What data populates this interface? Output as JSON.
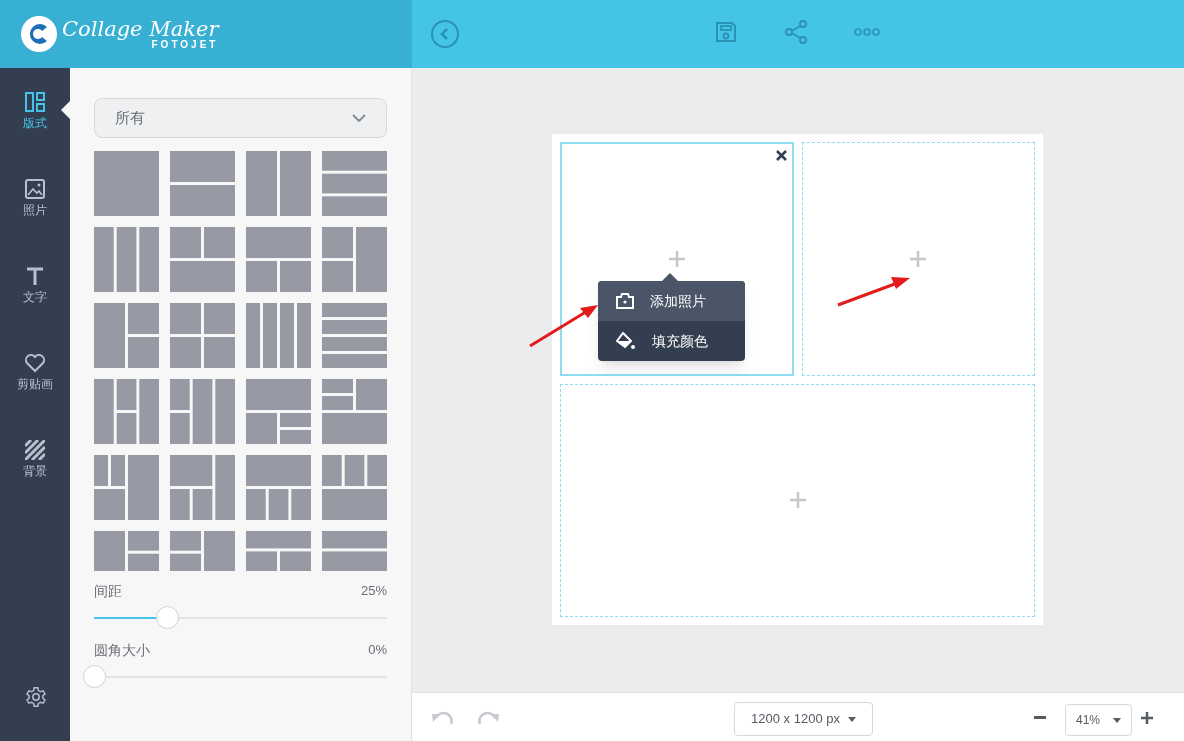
{
  "logo": {
    "title": "Collage Maker",
    "subtitle": "FOTOJET"
  },
  "nav": [
    {
      "kind": "layout",
      "label": "版式",
      "selected": true
    },
    {
      "kind": "photo",
      "label": "照片",
      "selected": false
    },
    {
      "kind": "text",
      "label": "文字",
      "selected": false
    },
    {
      "kind": "clipart",
      "label": "剪贴画",
      "selected": false
    },
    {
      "kind": "background",
      "label": "背景",
      "selected": false
    }
  ],
  "layout_panel": {
    "filter": "所有",
    "sliders": [
      {
        "label": "间距",
        "reading": "25%",
        "level": 0.25
      },
      {
        "label": "圆角大小",
        "reading": "0%",
        "level": 0
      }
    ]
  },
  "canvas": {
    "cells": [
      {
        "selected": true
      },
      {
        "selected": false
      },
      {
        "selected": false
      }
    ],
    "menu": [
      {
        "kind": "photo",
        "label": "添加照片",
        "selected": true
      },
      {
        "kind": "fill",
        "label": "填充颜色",
        "selected": false
      }
    ]
  },
  "bottom_bar": {
    "size": "1200 x 1200 px",
    "zoom": "41%"
  }
}
